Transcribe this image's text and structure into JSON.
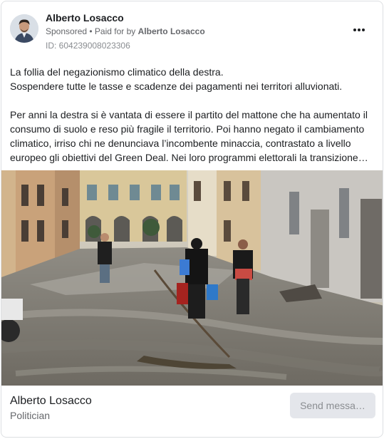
{
  "post": {
    "author": "Alberto Losacco",
    "sponsored_label": "Sponsored",
    "separator": " • ",
    "paid_for_prefix": "Paid for by ",
    "paid_for_name": "Alberto Losacco",
    "ad_id": "ID: 604239008023306",
    "more_icon": "more-horizontal-icon",
    "body": "La follia del negazionismo climatico della destra.\nSospendere tutte le tasse e scadenze dei pagamenti nei territori alluvionati.\n\nPer anni la destra si è vantata di essere il partito del mattone che ha aumentato il consumo di suolo e reso più fragile il territorio. Poi hanno negato il cambiamento climatico, irriso chi ne denunciava l’incombente minaccia, contrastato a livello europeo gli obiettivi del Green Deal. Nei loro programmi elettorali la transizione…"
  },
  "footer": {
    "name": "Alberto Losacco",
    "role": "Politician",
    "send_button": "Send messa…"
  }
}
